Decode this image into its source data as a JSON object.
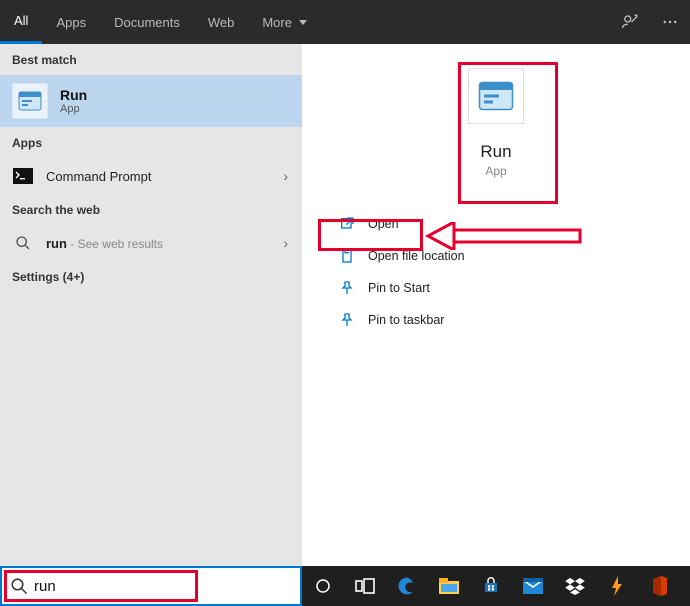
{
  "tabs": {
    "all": "All",
    "apps": "Apps",
    "documents": "Documents",
    "web": "Web",
    "more": "More"
  },
  "left": {
    "best_match_header": "Best match",
    "best_match": {
      "title": "Run",
      "subtitle": "App"
    },
    "apps_header": "Apps",
    "apps": {
      "command_prompt": "Command Prompt"
    },
    "web_header": "Search the web",
    "web": {
      "prefix": "run",
      "suffix": " - See web results"
    },
    "settings_header": "Settings (4+)"
  },
  "preview": {
    "title": "Run",
    "subtitle": "App"
  },
  "actions": {
    "open": "Open",
    "open_file_location": "Open file location",
    "pin_start": "Pin to Start",
    "pin_taskbar": "Pin to taskbar"
  },
  "search": {
    "value": "run"
  }
}
